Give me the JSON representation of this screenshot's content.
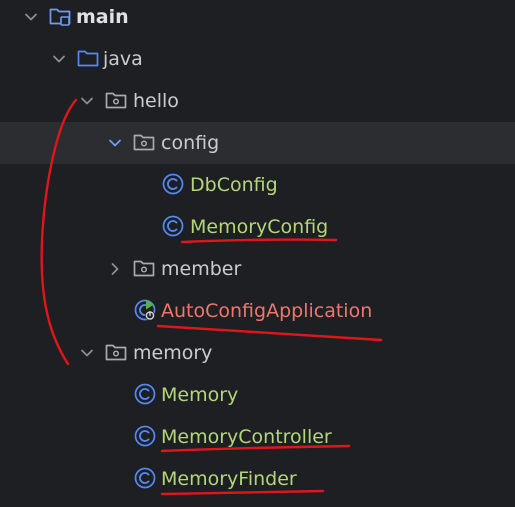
{
  "tree": {
    "nodes": [
      {
        "label": "main",
        "kind": "module-folder",
        "expanded": true,
        "icon": "module-folder-icon"
      },
      {
        "label": "java",
        "kind": "source-folder",
        "expanded": true,
        "icon": "source-folder-icon"
      },
      {
        "label": "hello",
        "kind": "package",
        "expanded": true,
        "icon": "package-icon"
      },
      {
        "label": "config",
        "kind": "package",
        "expanded": true,
        "selected": true,
        "icon": "package-icon"
      },
      {
        "label": "DbConfig",
        "kind": "class",
        "icon": "class-icon"
      },
      {
        "label": "MemoryConfig",
        "kind": "class",
        "icon": "class-icon"
      },
      {
        "label": "member",
        "kind": "package",
        "expanded": false,
        "icon": "package-icon"
      },
      {
        "label": "AutoConfigApplication",
        "kind": "main-class",
        "icon": "spring-boot-class-icon"
      },
      {
        "label": "memory",
        "kind": "package",
        "expanded": true,
        "icon": "package-icon"
      },
      {
        "label": "Memory",
        "kind": "class",
        "icon": "class-icon"
      },
      {
        "label": "MemoryController",
        "kind": "class",
        "icon": "class-icon"
      },
      {
        "label": "MemoryFinder",
        "kind": "class",
        "icon": "class-icon"
      }
    ]
  },
  "colors": {
    "background": "#1e1f22",
    "selected_row": "#2b2d30",
    "class_text": "#b3d67a",
    "main_class_text": "#f0766d",
    "folder_blue": "#548af7",
    "annotation_red": "#e0161b"
  }
}
